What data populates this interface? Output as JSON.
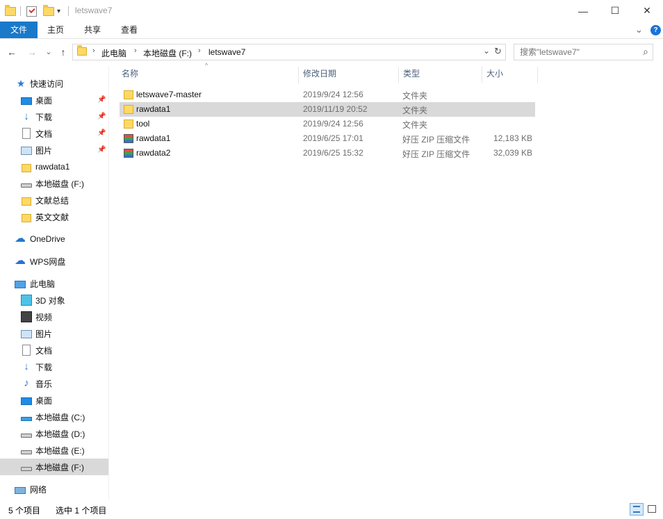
{
  "window": {
    "title": "letswave7",
    "minimize_glyph": "—",
    "maximize_glyph": "☐",
    "close_glyph": "✕",
    "quick_access_dropdown_glyph": "▾"
  },
  "ribbon": {
    "tabs": [
      "文件",
      "主页",
      "共享",
      "查看"
    ],
    "expand_glyph": "⌄",
    "help_glyph": "?"
  },
  "nav": {
    "back_glyph": "←",
    "forward_glyph": "→",
    "recent_glyph": "⌄",
    "up_glyph": "↑",
    "breadcrumb": [
      "此电脑",
      "本地磁盘 (F:)",
      "letswave7"
    ],
    "crumb_sep": "›",
    "dropdown_glyph": "⌄",
    "refresh_glyph": "↻",
    "search_placeholder": "搜索\"letswave7\"",
    "search_glyph": "⌕"
  },
  "sidebar": {
    "quick_access": "快速访问",
    "quick_items": [
      "桌面",
      "下载",
      "文档",
      "图片",
      "rawdata1",
      "本地磁盘 (F:)",
      "文献总结",
      "英文文献"
    ],
    "pin_glyph": "📌",
    "onedrive": "OneDrive",
    "wps": "WPS网盘",
    "this_pc": "此电脑",
    "pc_items": [
      "3D 对象",
      "视频",
      "图片",
      "文档",
      "下载",
      "音乐",
      "桌面",
      "本地磁盘 (C:)",
      "本地磁盘 (D:)",
      "本地磁盘 (E:)",
      "本地磁盘 (F:)"
    ],
    "network": "网络"
  },
  "columns": {
    "name": "名称",
    "date": "修改日期",
    "type": "类型",
    "size": "大小",
    "sort_glyph": "^"
  },
  "files": [
    {
      "name": "letswave7-master",
      "date": "2019/9/24 12:56",
      "type": "文件夹",
      "size": "",
      "icon": "folder-icon"
    },
    {
      "name": "rawdata1",
      "date": "2019/11/19 20:52",
      "type": "文件夹",
      "size": "",
      "icon": "folder-icon"
    },
    {
      "name": "tool",
      "date": "2019/9/24 12:56",
      "type": "文件夹",
      "size": "",
      "icon": "folder-icon"
    },
    {
      "name": "rawdata1",
      "date": "2019/6/25 17:01",
      "type": "好压 ZIP 压缩文件",
      "size": "12,183 KB",
      "icon": "zip-archive-icon"
    },
    {
      "name": "rawdata2",
      "date": "2019/6/25 15:32",
      "type": "好压 ZIP 压缩文件",
      "size": "32,039 KB",
      "icon": "zip-archive-icon"
    }
  ],
  "status": {
    "count": "5 个项目",
    "selection": "选中 1 个项目"
  },
  "colors": {
    "accent": "#1979ca",
    "selection": "#d9d9d9",
    "header_text": "#4c607a"
  }
}
